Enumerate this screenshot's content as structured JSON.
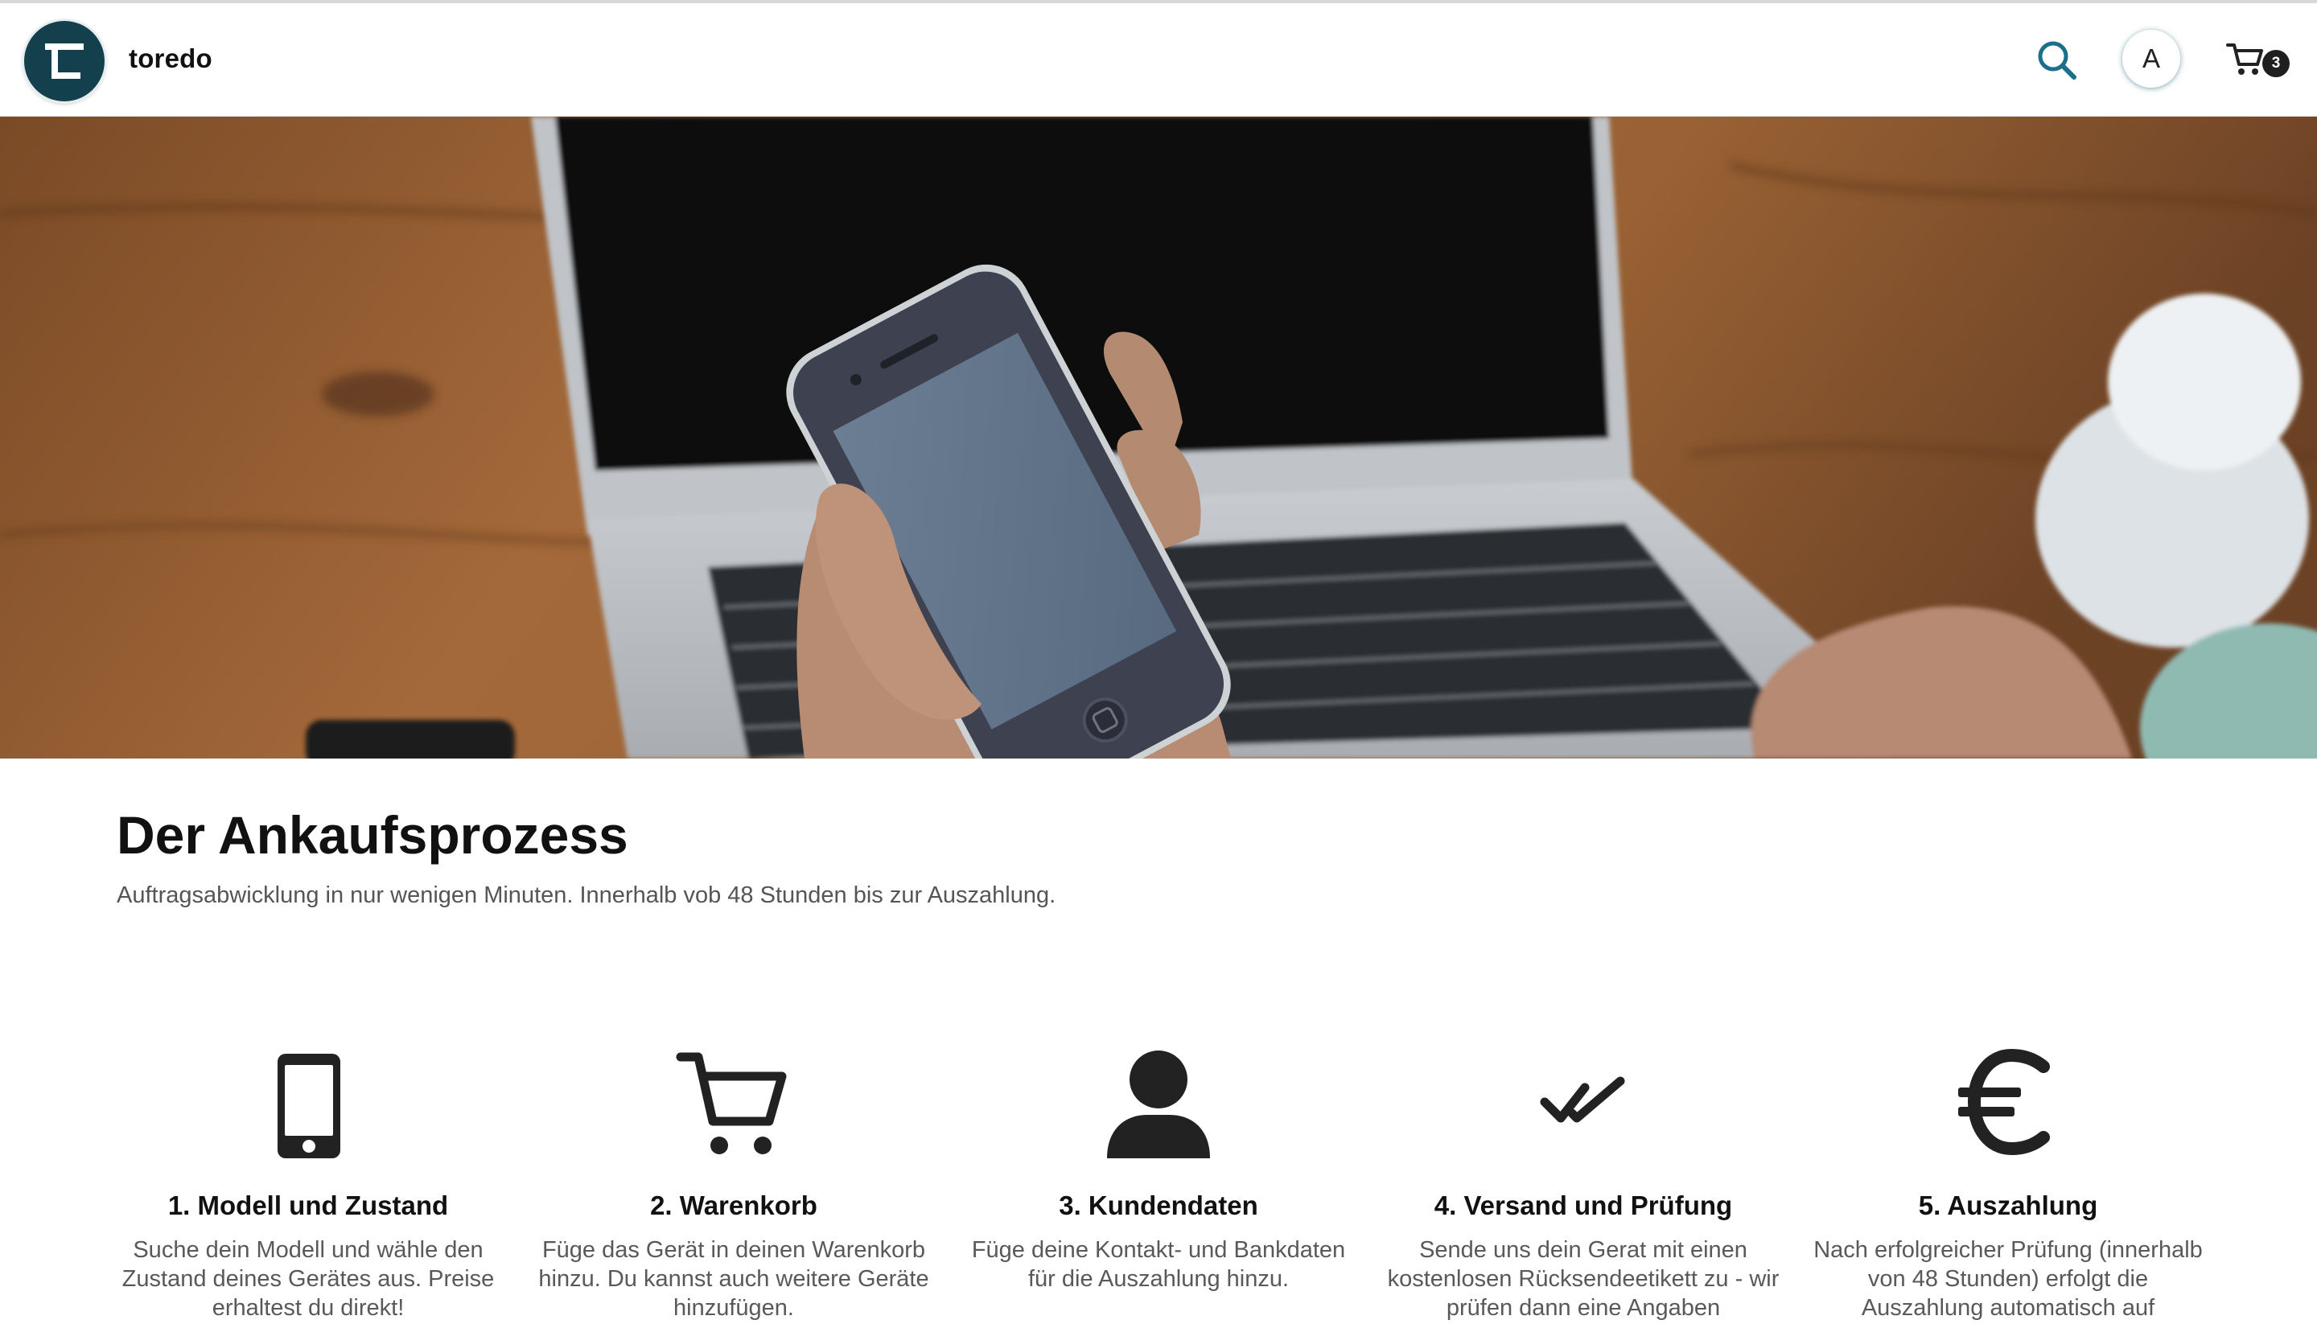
{
  "header": {
    "brand": "toredo",
    "avatar_initial": "A",
    "cart_count": "3",
    "icons": {
      "search": "search-icon",
      "cart": "cart-icon",
      "logo": "toredo-logo"
    }
  },
  "hero": {
    "image": "hand-holding-smartphone-over-laptop"
  },
  "process": {
    "title": "Der Ankaufsprozess",
    "subtitle": "Auftragsabwicklung in nur wenigen Minuten. Innerhalb vob 48 Stunden bis zur Auszahlung.",
    "steps": [
      {
        "icon": "smartphone-icon",
        "title": "1. Modell und Zustand",
        "desc": "Suche dein Modell und wähle den Zustand deines Gerätes aus. Preise erhaltest du direkt!"
      },
      {
        "icon": "cart-icon",
        "title": "2. Warenkorb",
        "desc": "Füge das Gerät in deinen Warenkorb hinzu. Du kannst auch weitere Geräte hinzufügen."
      },
      {
        "icon": "user-icon",
        "title": "3. Kundendaten",
        "desc": "Füge deine Kontakt- und Bankdaten für die Auszahlung hinzu."
      },
      {
        "icon": "double-check-icon",
        "title": "4. Versand und Prüfung",
        "desc": "Sende uns dein Gerat mit einen kostenlosen Rücksendeetikett zu - wir prüfen dann eine Angaben"
      },
      {
        "icon": "euro-icon",
        "title": "5. Auszahlung",
        "desc": "Nach erfolgreicher Prüfung (innerhalb von 48 Stunden) erfolgt die Auszahlung automatisch auf"
      }
    ]
  },
  "colors": {
    "brand": "#143f4d",
    "accent": "#1b6f8a",
    "text": "#111111",
    "muted": "#595959"
  }
}
